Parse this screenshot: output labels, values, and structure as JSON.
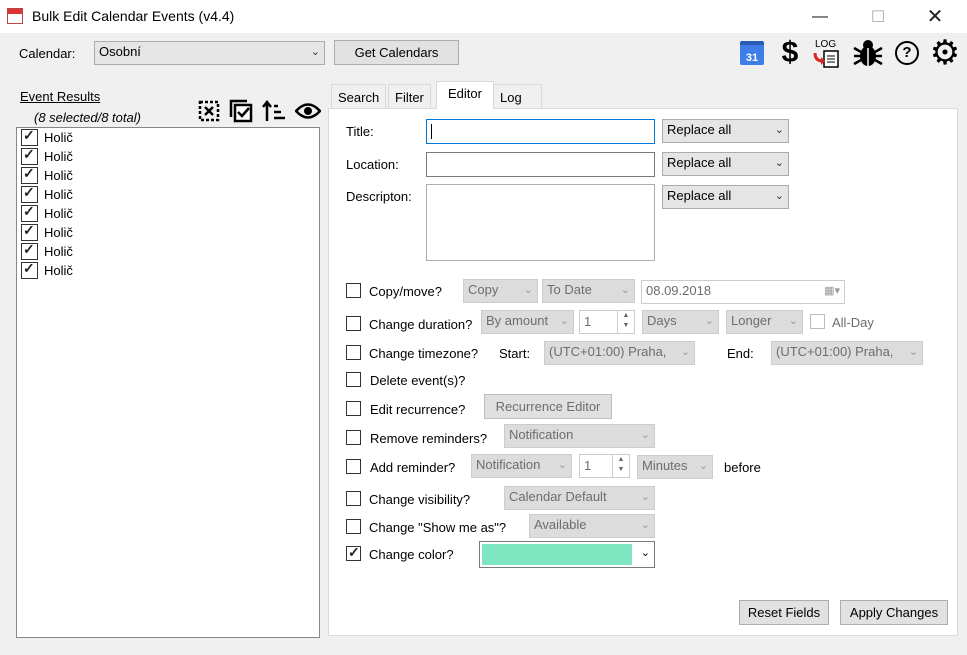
{
  "window": {
    "title": "Bulk Edit Calendar Events (v4.4)",
    "minimize_icon": "minimize-icon",
    "maximize_icon": "maximize-icon",
    "close_icon": "close-icon"
  },
  "toolbar": {
    "calendar_label": "Calendar:",
    "calendar_value": "Osobní",
    "get_calendars_label": "Get Calendars",
    "icons": [
      "google-calendar-icon",
      "dollar-icon",
      "log-file-icon",
      "bug-icon",
      "help-icon",
      "gear-icon"
    ],
    "calendar_icon_text": "31",
    "log_icon_text": "LOG"
  },
  "results": {
    "title": "Event Results",
    "summary": "(8 selected/8 total)",
    "icons": [
      "select-none-icon",
      "select-all-icon",
      "sort-icon",
      "view-icon"
    ],
    "items": [
      {
        "label": "Holič",
        "checked": true
      },
      {
        "label": "Holič",
        "checked": true
      },
      {
        "label": "Holič",
        "checked": true
      },
      {
        "label": "Holič",
        "checked": true
      },
      {
        "label": "Holič",
        "checked": true
      },
      {
        "label": "Holič",
        "checked": true
      },
      {
        "label": "Holič",
        "checked": true
      },
      {
        "label": "Holič",
        "checked": true
      }
    ]
  },
  "tabs": {
    "search": "Search",
    "filter": "Filter",
    "editor": "Editor",
    "log": "Log",
    "active": "Editor"
  },
  "editor": {
    "title_label": "Title:",
    "title_value": "",
    "title_mode": "Replace all",
    "location_label": "Location:",
    "location_value": "",
    "location_mode": "Replace all",
    "description_label": "Descripton:",
    "description_value": "",
    "description_mode": "Replace all",
    "copy_move": {
      "label": "Copy/move?",
      "checked": false,
      "action": "Copy",
      "target": "To Date",
      "date": "08.09.2018"
    },
    "change_duration": {
      "label": "Change duration?",
      "checked": false,
      "method": "By amount",
      "amount": "1",
      "unit": "Days",
      "direction": "Longer",
      "allday_label": "All-Day",
      "allday_checked": false
    },
    "change_timezone": {
      "label": "Change timezone?",
      "checked": false,
      "start_label": "Start:",
      "start_value": "(UTC+01:00) Praha,",
      "end_label": "End:",
      "end_value": "(UTC+01:00) Praha,"
    },
    "delete_events": {
      "label": "Delete event(s)?",
      "checked": false
    },
    "edit_recurrence": {
      "label": "Edit recurrence?",
      "checked": false,
      "button": "Recurrence Editor"
    },
    "remove_reminders": {
      "label": "Remove reminders?",
      "checked": false,
      "type": "Notification"
    },
    "add_reminder": {
      "label": "Add reminder?",
      "checked": false,
      "type": "Notification",
      "amount": "1",
      "unit": "Minutes",
      "suffix": "before"
    },
    "change_visibility": {
      "label": "Change visibility?",
      "checked": false,
      "value": "Calendar Default"
    },
    "change_show_as": {
      "label": "Change \"Show me as\"?",
      "checked": false,
      "value": "Available"
    },
    "change_color": {
      "label": "Change color?",
      "checked": true,
      "color": "#7ee6c0"
    },
    "reset_label": "Reset Fields",
    "apply_label": "Apply Changes"
  }
}
